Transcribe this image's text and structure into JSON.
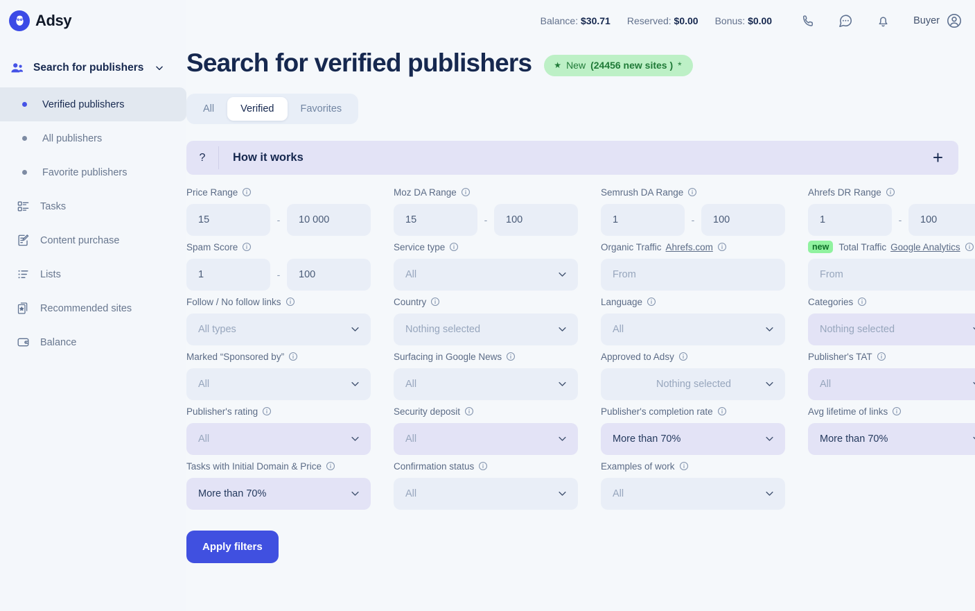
{
  "brand": {
    "name": "Adsy",
    "logo_icon": "owl-logo-icon",
    "color": "#3b4ae6"
  },
  "sidebar": {
    "section_header": {
      "label": "Search for publishers",
      "icon": "people-icon",
      "chevron": "chevron-down-icon"
    },
    "items": [
      {
        "label": "Verified publishers",
        "icon": "bullet-dot-icon",
        "active": true
      },
      {
        "label": "All publishers",
        "icon": "bullet-dot-icon",
        "active": false
      },
      {
        "label": "Favorite publishers",
        "icon": "bullet-dot-icon",
        "active": false
      },
      {
        "label": "Tasks",
        "icon": "tasks-icon",
        "active": false
      },
      {
        "label": "Content purchase",
        "icon": "document-edit-icon",
        "active": false
      },
      {
        "label": "Lists",
        "icon": "list-icon",
        "active": false
      },
      {
        "label": "Recommended sites",
        "icon": "star-page-icon",
        "active": false
      },
      {
        "label": "Balance",
        "icon": "wallet-icon",
        "active": false
      }
    ]
  },
  "topbar": {
    "balances": [
      {
        "label": "Balance:",
        "value": "$30.71"
      },
      {
        "label": "Reserved:",
        "value": "$0.00"
      },
      {
        "label": "Bonus:",
        "value": "$0.00"
      }
    ],
    "icons": [
      "phone-icon",
      "chat-icon",
      "bell-icon"
    ],
    "user": {
      "label": "Buyer",
      "icon": "user-avatar-icon"
    }
  },
  "header": {
    "title": "Search for verified publishers",
    "badge": {
      "star": "★",
      "lead": "New",
      "bold": "(24456 new sites )",
      "suffix": "*"
    }
  },
  "tabs": [
    {
      "label": "All",
      "active": false
    },
    {
      "label": "Verified",
      "active": true
    },
    {
      "label": "Favorites",
      "active": false
    }
  ],
  "how_it_works": {
    "marker": "?",
    "label": "How it works",
    "toggle_icon": "plus-icon"
  },
  "filters": {
    "rows": [
      [
        {
          "name": "price-range",
          "label": "Price Range",
          "type": "range",
          "from": "15",
          "to": "10 000",
          "dash": "-"
        },
        {
          "name": "moz-da-range",
          "label": "Moz DA Range",
          "type": "range",
          "from": "15",
          "to": "100",
          "dash": "-"
        },
        {
          "name": "semrush-da-range",
          "label": "Semrush DA Range",
          "type": "range",
          "from": "1",
          "to": "100",
          "dash": "-"
        },
        {
          "name": "ahrefs-dr-range",
          "label": "Ahrefs DR Range",
          "type": "range",
          "from": "1",
          "to": "100",
          "dash": "-"
        }
      ],
      [
        {
          "name": "spam-score",
          "label": "Spam Score",
          "type": "range",
          "from": "1",
          "to": "100",
          "dash": "-"
        },
        {
          "name": "service-type",
          "label": "Service type",
          "type": "select",
          "value": "All",
          "filled": false,
          "tint": "blue"
        },
        {
          "name": "organic-traffic",
          "label": "Organic Traffic",
          "link": "Ahrefs.com",
          "type": "text",
          "value": "From"
        },
        {
          "name": "total-traffic",
          "label": "Total Traffic",
          "link": "Google Analytics",
          "badge": "new",
          "type": "text",
          "value": "From"
        }
      ],
      [
        {
          "name": "follow-no-follow-links",
          "label": "Follow / No follow links",
          "type": "select",
          "value": "All types",
          "filled": false,
          "tint": "blue"
        },
        {
          "name": "country",
          "label": "Country",
          "type": "select",
          "value": "Nothing selected",
          "filled": false,
          "tint": "blue"
        },
        {
          "name": "language",
          "label": "Language",
          "type": "select",
          "value": "All",
          "filled": false,
          "tint": "blue"
        },
        {
          "name": "categories",
          "label": "Categories",
          "type": "select",
          "value": "Nothing selected",
          "filled": false,
          "tint": "lavender"
        }
      ],
      [
        {
          "name": "marked-sponsored-by",
          "label": "Marked “Sponsored by”",
          "type": "select",
          "value": "All",
          "filled": false,
          "tint": "blue"
        },
        {
          "name": "surfacing-in-google-news",
          "label": "Surfacing in Google News",
          "type": "select",
          "value": "All",
          "filled": false,
          "tint": "blue"
        },
        {
          "name": "approved-to-adsy",
          "label": "Approved to Adsy",
          "type": "select",
          "value": "Nothing selected",
          "filled": false,
          "tint": "blue",
          "align": "center"
        },
        {
          "name": "publishers-tat",
          "label": "Publisher's TAT",
          "type": "select",
          "value": "All",
          "filled": false,
          "tint": "lavender"
        }
      ],
      [
        {
          "name": "publishers-rating",
          "label": "Publisher's rating",
          "type": "select",
          "value": "All",
          "filled": false,
          "tint": "lavender"
        },
        {
          "name": "security-deposit",
          "label": "Security deposit",
          "type": "select",
          "value": "All",
          "filled": false,
          "tint": "lavender"
        },
        {
          "name": "publishers-completion-rate",
          "label": "Publisher's completion rate",
          "type": "select",
          "value": "More than 70%",
          "filled": true,
          "tint": "lavender"
        },
        {
          "name": "avg-lifetime-of-links",
          "label": "Avg lifetime of links",
          "type": "select",
          "value": "More than 70%",
          "filled": true,
          "tint": "lavender"
        }
      ],
      [
        {
          "name": "tasks-with-initial-domain-price",
          "label": "Tasks with Initial Domain & Price",
          "type": "select",
          "value": "More than 70%",
          "filled": true,
          "tint": "lavender"
        },
        {
          "name": "confirmation-status",
          "label": "Confirmation status",
          "type": "select",
          "value": "All",
          "filled": false,
          "tint": "blue"
        },
        {
          "name": "examples-of-work",
          "label": "Examples of work",
          "type": "select",
          "value": "All",
          "filled": false,
          "tint": "blue"
        }
      ]
    ],
    "apply_label": "Apply filters"
  }
}
